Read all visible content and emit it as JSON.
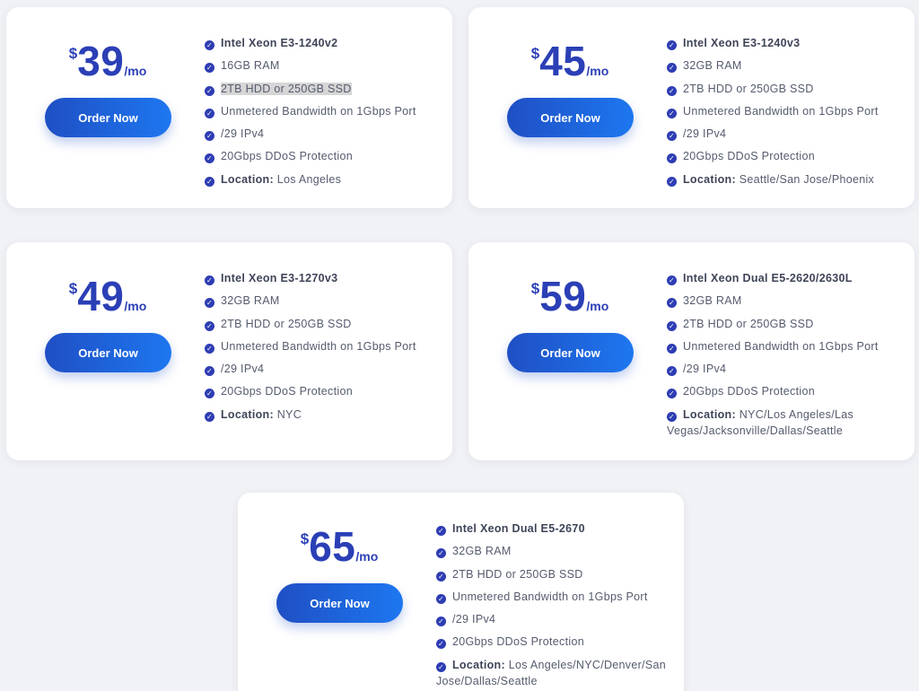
{
  "currency": "$",
  "period": "/mo",
  "order_label": "Order Now",
  "check_icon": "check-circle-icon",
  "accent_color": "#2b3fb6",
  "button_gradient": [
    "#1f4fc4",
    "#1e77f0"
  ],
  "plans": [
    {
      "price": "39",
      "cpu": "Intel Xeon E3-1240v2",
      "ram": "16GB RAM",
      "storage": "2TB HDD or 250GB SSD",
      "bandwidth": "Unmetered Bandwidth on 1Gbps Port",
      "ip": "/29 IPv4",
      "ddos": "20Gbps DDoS Protection",
      "location_label": "Location:",
      "location": "Los Angeles"
    },
    {
      "price": "45",
      "cpu": "Intel Xeon E3-1240v3",
      "ram": "32GB RAM",
      "storage": "2TB HDD or 250GB SSD",
      "bandwidth": "Unmetered Bandwidth on 1Gbps Port",
      "ip": "/29 IPv4",
      "ddos": "20Gbps DDoS Protection",
      "location_label": "Location:",
      "location": "Seattle/San Jose/Phoenix"
    },
    {
      "price": "49",
      "cpu": "Intel Xeon E3-1270v3",
      "ram": "32GB RAM",
      "storage": "2TB HDD or 250GB SSD",
      "bandwidth": "Unmetered Bandwidth on 1Gbps Port",
      "ip": "/29 IPv4",
      "ddos": "20Gbps DDoS Protection",
      "location_label": "Location:",
      "location": "NYC"
    },
    {
      "price": "59",
      "cpu": "Intel Xeon Dual E5-2620/2630L",
      "ram": "32GB RAM",
      "storage": "2TB HDD or 250GB SSD",
      "bandwidth": "Unmetered Bandwidth on 1Gbps Port",
      "ip": "/29 IPv4",
      "ddos": "20Gbps DDoS Protection",
      "location_label": "Location:",
      "location": "NYC/Los Angeles/Las Vegas/Jacksonville/Dallas/Seattle"
    },
    {
      "price": "65",
      "cpu": "Intel Xeon Dual E5-2670",
      "ram": "32GB RAM",
      "storage": "2TB HDD or 250GB SSD",
      "bandwidth": "Unmetered Bandwidth on 1Gbps Port",
      "ip": "/29 IPv4",
      "ddos": "20Gbps DDoS Protection",
      "location_label": "Location:",
      "location": "Los Angeles/NYC/Denver/San Jose/Dallas/Seattle"
    }
  ]
}
